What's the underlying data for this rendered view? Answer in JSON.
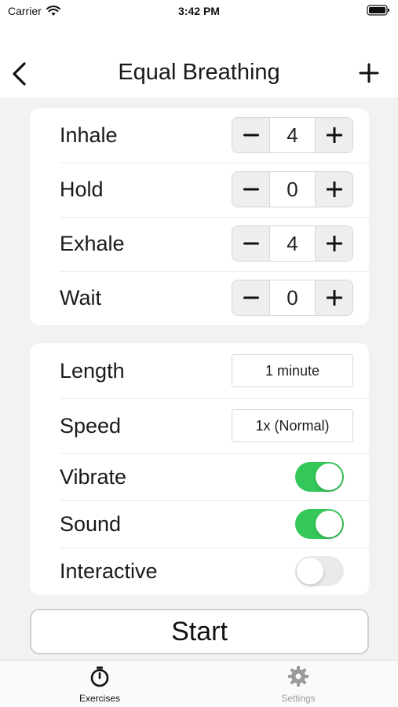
{
  "status_bar": {
    "carrier": "Carrier",
    "time": "3:42 PM"
  },
  "nav": {
    "title": "Equal Breathing",
    "back_icon": "chevron-left-icon",
    "add_icon": "plus-icon"
  },
  "breath_steps": [
    {
      "label": "Inhale",
      "value": "4"
    },
    {
      "label": "Hold",
      "value": "0"
    },
    {
      "label": "Exhale",
      "value": "4"
    },
    {
      "label": "Wait",
      "value": "0"
    }
  ],
  "settings": {
    "length": {
      "label": "Length",
      "value": "1 minute"
    },
    "speed": {
      "label": "Speed",
      "value": "1x (Normal)"
    },
    "vibrate": {
      "label": "Vibrate",
      "on": true
    },
    "sound": {
      "label": "Sound",
      "on": true
    },
    "interactive": {
      "label": "Interactive",
      "on": false
    }
  },
  "start_label": "Start",
  "tabs": [
    {
      "label": "Exercises",
      "icon": "stopwatch-icon",
      "selected": true
    },
    {
      "label": "Settings",
      "icon": "gear-icon",
      "selected": false
    }
  ],
  "colors": {
    "toggle_on": "#34c759",
    "toggle_off": "#e9e9ea",
    "background": "#f2f2f2"
  }
}
